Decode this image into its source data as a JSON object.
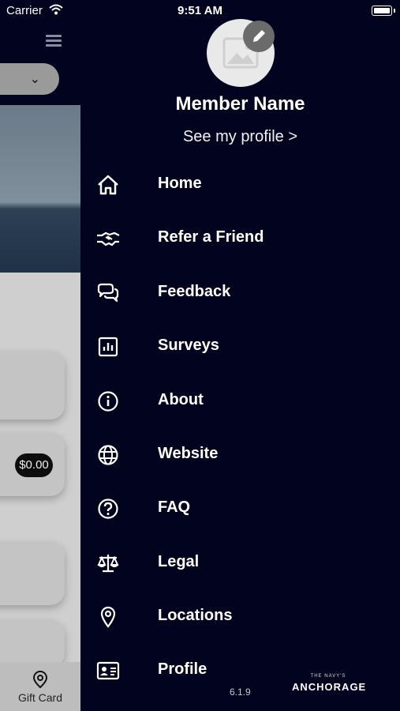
{
  "status_bar": {
    "carrier": "Carrier",
    "time": "9:51 AM"
  },
  "background_page": {
    "balance_pill": "$0.00",
    "tab_label": "Gift Card"
  },
  "drawer": {
    "member_name": "Member Name",
    "see_profile": "See my profile >",
    "menu": [
      {
        "label": "Home",
        "icon": "home-icon"
      },
      {
        "label": "Refer a Friend",
        "icon": "handshake-icon"
      },
      {
        "label": "Feedback",
        "icon": "chat-bubbles-icon"
      },
      {
        "label": "Surveys",
        "icon": "bar-chart-icon"
      },
      {
        "label": "About",
        "icon": "info-icon"
      },
      {
        "label": "Website",
        "icon": "globe-icon"
      },
      {
        "label": "FAQ",
        "icon": "question-icon"
      },
      {
        "label": "Legal",
        "icon": "scales-icon"
      },
      {
        "label": "Locations",
        "icon": "map-pin-icon"
      },
      {
        "label": "Profile",
        "icon": "id-card-icon"
      }
    ],
    "version": "6.1.9",
    "logo": {
      "top_text": "THE NAVY'S",
      "main_text": "ANCHORAGE"
    }
  },
  "colors": {
    "drawer_bg": "#02031f",
    "text": "#ffffff"
  }
}
